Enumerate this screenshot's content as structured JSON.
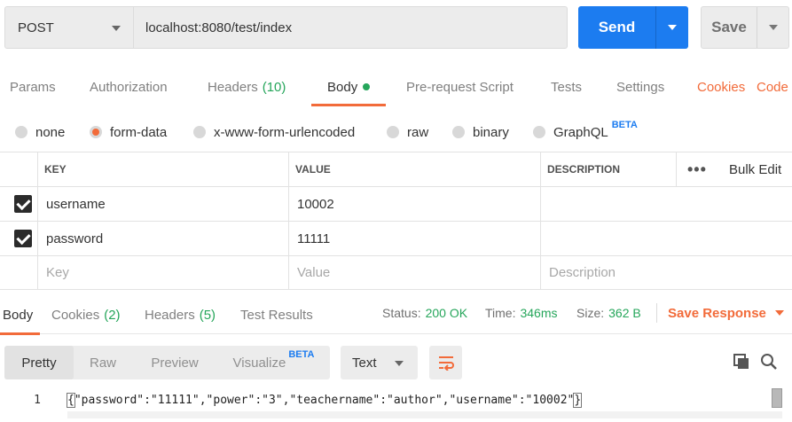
{
  "request": {
    "method": "POST",
    "url": "localhost:8080/test/index",
    "send_label": "Send",
    "save_label": "Save"
  },
  "request_tabs": [
    {
      "label": "Params",
      "count": "",
      "active": false
    },
    {
      "label": "Authorization",
      "count": "",
      "active": false
    },
    {
      "label": "Headers",
      "count": "(10)",
      "active": false
    },
    {
      "label": "Body",
      "count": "",
      "active": true
    },
    {
      "label": "Pre-request Script",
      "count": "",
      "active": false
    },
    {
      "label": "Tests",
      "count": "",
      "active": false
    },
    {
      "label": "Settings",
      "count": "",
      "active": false
    }
  ],
  "request_links": {
    "cookies": "Cookies",
    "code": "Code"
  },
  "body_types": [
    {
      "label": "none",
      "selected": false
    },
    {
      "label": "form-data",
      "selected": true
    },
    {
      "label": "x-www-form-urlencoded",
      "selected": false
    },
    {
      "label": "raw",
      "selected": false
    },
    {
      "label": "binary",
      "selected": false
    },
    {
      "label": "GraphQL",
      "selected": false,
      "badge": "BETA"
    }
  ],
  "params_table": {
    "headers": {
      "key": "KEY",
      "value": "VALUE",
      "description": "DESCRIPTION"
    },
    "more": "•••",
    "bulk_edit": "Bulk Edit",
    "rows": [
      {
        "key": "username",
        "value": "10002",
        "description": "",
        "checked": true
      },
      {
        "key": "password",
        "value": "11111",
        "description": "",
        "checked": true
      }
    ],
    "placeholders": {
      "key": "Key",
      "value": "Value",
      "description": "Description"
    }
  },
  "response_tabs": [
    {
      "label": "Body",
      "count": ""
    },
    {
      "label": "Cookies",
      "count": "(2)"
    },
    {
      "label": "Headers",
      "count": "(5)"
    },
    {
      "label": "Test Results",
      "count": ""
    }
  ],
  "response_meta": {
    "status_label": "Status:",
    "status_value": "200 OK",
    "time_label": "Time:",
    "time_value": "346ms",
    "size_label": "Size:",
    "size_value": "362 B",
    "save_response": "Save Response"
  },
  "response_views": {
    "pretty": "Pretty",
    "raw": "Raw",
    "preview": "Preview",
    "visualize": "Visualize",
    "visualize_badge": "BETA",
    "format": "Text"
  },
  "code": {
    "line_number": "1",
    "open_brace": "{",
    "body": "\"password\":\"11111\",\"power\":\"3\",\"teachername\":\"author\",\"username\":\"10002\"",
    "close_brace": "}"
  },
  "colors": {
    "accent": "#f26b3a",
    "primary": "#1c7cf0",
    "success": "#26a65b"
  }
}
